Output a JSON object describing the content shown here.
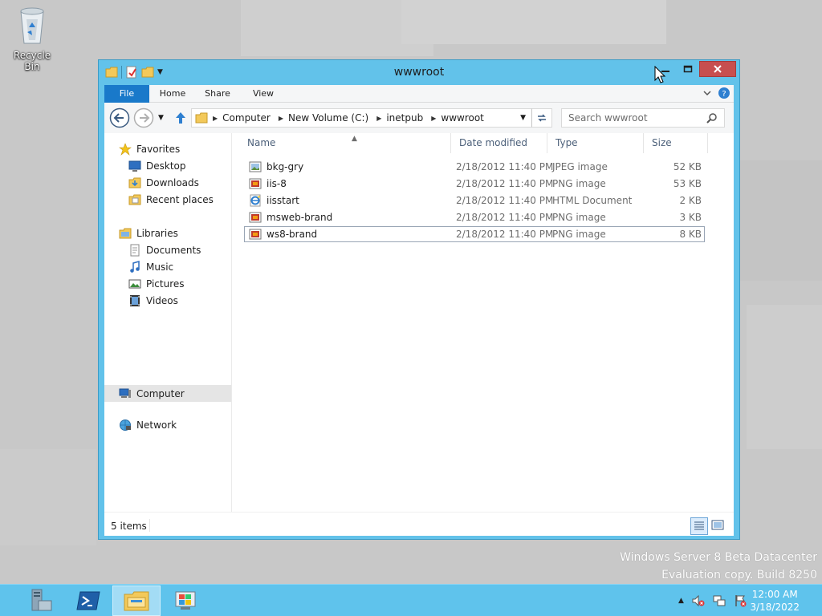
{
  "desktop": {
    "recycle_bin_label": "Recycle Bin",
    "watermark_line1": "Windows Server 8 Beta Datacenter",
    "watermark_line2": "Evaluation copy. Build 8250"
  },
  "window": {
    "title": "wwwroot",
    "ribbon_tabs": {
      "file": "File",
      "home": "Home",
      "share": "Share",
      "view": "View"
    },
    "address": {
      "crumbs": [
        "Computer",
        "New Volume (C:)",
        "inetpub",
        "wwwroot"
      ]
    },
    "search": {
      "placeholder": "Search wwwroot"
    },
    "navpane": {
      "favorites": "Favorites",
      "desktop": "Desktop",
      "downloads": "Downloads",
      "recent_places": "Recent places",
      "libraries": "Libraries",
      "documents": "Documents",
      "music": "Music",
      "pictures": "Pictures",
      "videos": "Videos",
      "computer": "Computer",
      "network": "Network"
    },
    "columns": {
      "name": "Name",
      "date": "Date modified",
      "type": "Type",
      "size": "Size"
    },
    "files": [
      {
        "name": "bkg-gry",
        "date": "2/18/2012 11:40 PM",
        "type": "JPEG image",
        "size": "52 KB",
        "icon": "jpeg-icon"
      },
      {
        "name": "iis-8",
        "date": "2/18/2012 11:40 PM",
        "type": "PNG image",
        "size": "53 KB",
        "icon": "png-icon"
      },
      {
        "name": "iisstart",
        "date": "2/18/2012 11:40 PM",
        "type": "HTML Document",
        "size": "2 KB",
        "icon": "html-icon"
      },
      {
        "name": "msweb-brand",
        "date": "2/18/2012 11:40 PM",
        "type": "PNG image",
        "size": "3 KB",
        "icon": "png-icon"
      },
      {
        "name": "ws8-brand",
        "date": "2/18/2012 11:40 PM",
        "type": "PNG image",
        "size": "8 KB",
        "icon": "png-icon"
      }
    ],
    "status": {
      "item_count": "5 items"
    }
  },
  "taskbar": {
    "clock_time": "12:00 AM",
    "clock_date": "3/18/2022"
  },
  "colors": {
    "window_frame": "#62c2ea",
    "file_tab": "#1979ca",
    "close_button": "#c74f4f",
    "taskbar": "#5fc3ec"
  }
}
